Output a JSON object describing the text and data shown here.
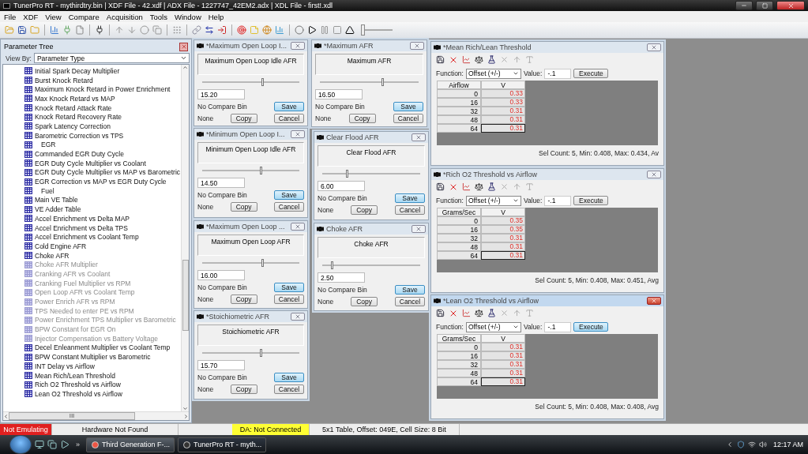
{
  "window": {
    "title": "TunerPro RT - mythirdtry.bin | XDF File - 42.xdf | ADX File - 1227747_42EM2.adx | XDL File - first!.xdl"
  },
  "menu": [
    "File",
    "XDF",
    "View",
    "Compare",
    "Acquisition",
    "Tools",
    "Window",
    "Help"
  ],
  "toolbar_slider": {
    "level": 0
  },
  "parameter_tree": {
    "title": "Parameter Tree",
    "view_by_label": "View By:",
    "view_by_value": "Parameter Type",
    "items": [
      {
        "label": "Initial Spark Decay Multiplier",
        "kind": "table",
        "dimmed": false
      },
      {
        "label": "Burst Knock Retard",
        "kind": "table",
        "dimmed": false
      },
      {
        "label": "Maximum Knock Retard in Power Enrichment",
        "kind": "table",
        "dimmed": false
      },
      {
        "label": "Max Knock Retard vs MAP",
        "kind": "table",
        "dimmed": false
      },
      {
        "label": "Knock Retard Attack Rate",
        "kind": "table",
        "dimmed": false
      },
      {
        "label": "Knock Retard Recovery Rate",
        "kind": "table",
        "dimmed": false
      },
      {
        "label": "Spark Latency Correction",
        "kind": "table",
        "dimmed": false
      },
      {
        "label": "Barometric Correction vs TPS",
        "kind": "table",
        "dimmed": false
      },
      {
        "label": "EGR",
        "kind": "category",
        "dimmed": false
      },
      {
        "label": "Commanded EGR Duty Cycle",
        "kind": "table",
        "dimmed": false
      },
      {
        "label": "EGR Duty Cycle Multiplier vs Coolant",
        "kind": "table",
        "dimmed": false
      },
      {
        "label": "EGR Duty Cycle Multiplier vs MAP vs Barometric",
        "kind": "table",
        "dimmed": false
      },
      {
        "label": "EGR Correction vs MAP vs EGR Duty Cycle",
        "kind": "table",
        "dimmed": false
      },
      {
        "label": "Fuel",
        "kind": "category",
        "dimmed": false
      },
      {
        "label": "Main VE Table",
        "kind": "table",
        "dimmed": false
      },
      {
        "label": "VE Adder Table",
        "kind": "table",
        "dimmed": false
      },
      {
        "label": "Accel Enrichment vs Delta MAP",
        "kind": "table",
        "dimmed": false
      },
      {
        "label": "Accel Enrichment vs Delta TPS",
        "kind": "table",
        "dimmed": false
      },
      {
        "label": "Accel Enrichment vs Coolant Temp",
        "kind": "table",
        "dimmed": false
      },
      {
        "label": "Cold Engine AFR",
        "kind": "table",
        "dimmed": false
      },
      {
        "label": "Choke AFR",
        "kind": "table",
        "dimmed": false
      },
      {
        "label": "Choke AFR Multiplier",
        "kind": "table",
        "dimmed": true
      },
      {
        "label": "Cranking AFR vs Coolant",
        "kind": "table",
        "dimmed": true
      },
      {
        "label": "Cranking Fuel Multiplier vs RPM",
        "kind": "table",
        "dimmed": true
      },
      {
        "label": "Open Loop AFR vs Coolant Temp",
        "kind": "table",
        "dimmed": true
      },
      {
        "label": "Power Enrich AFR vs RPM",
        "kind": "table",
        "dimmed": true
      },
      {
        "label": "TPS Needed to enter PE vs RPM",
        "kind": "table",
        "dimmed": true
      },
      {
        "label": "Power Enrichment TPS Multiplier vs Barometric",
        "kind": "table",
        "dimmed": true
      },
      {
        "label": "BPW Constant for EGR On",
        "kind": "table",
        "dimmed": true
      },
      {
        "label": "Injector Compensation vs Battery Voltage",
        "kind": "table",
        "dimmed": true
      },
      {
        "label": "Decel Enleanment Multiplier vs Coolant Temp",
        "kind": "table",
        "dimmed": false
      },
      {
        "label": "BPW Constant Multiplier vs Barometric",
        "kind": "table",
        "dimmed": false
      },
      {
        "label": "INT Delay vs Airflow",
        "kind": "table",
        "dimmed": false
      },
      {
        "label": "Mean Rich/Lean Threshold",
        "kind": "table",
        "dimmed": false
      },
      {
        "label": "Rich O2 Threshold vs Airflow",
        "kind": "table",
        "dimmed": false
      },
      {
        "label": "Lean O2 Threshold vs Airflow",
        "kind": "table",
        "dimmed": false
      }
    ],
    "scroll_more": "III"
  },
  "scalar_windows": [
    {
      "title": "*Maximum Open Loop I...",
      "label": "Maximum Open Loop Idle AFR",
      "level": 0.62,
      "value": "15.20",
      "compare": "No Compare Bin",
      "compare_source": "None",
      "save": "Save",
      "copy": "Copy",
      "cancel": "Cancel"
    },
    {
      "title": "*Maximum AFR",
      "label": "Maximum AFR",
      "level": 0.63,
      "value": "16.50",
      "compare": "No Compare Bin",
      "compare_source": "None",
      "save": "Save",
      "copy": "Copy",
      "cancel": "Cancel"
    },
    {
      "title": "*Minimum Open Loop I...",
      "label": "Minimum Open Loop Idle AFR",
      "level": 0.6,
      "value": "14.50",
      "compare": "No Compare Bin",
      "compare_source": "None",
      "save": "Save",
      "copy": "Copy",
      "cancel": "Cancel"
    },
    {
      "title": "Clear Flood AFR",
      "label": "Clear Flood AFR",
      "level": 0.25,
      "value": "6.00",
      "compare": "No Compare Bin",
      "compare_source": "None",
      "save": "Save",
      "copy": "Copy",
      "cancel": "Cancel"
    },
    {
      "title": "*Maximum Open Loop ...",
      "label": "Maximum Open Loop AFR",
      "level": 0.62,
      "value": "16.00",
      "compare": "No Compare Bin",
      "compare_source": "None",
      "save": "Save",
      "copy": "Copy",
      "cancel": "Cancel"
    },
    {
      "title": "Choke AFR",
      "label": "Choke AFR",
      "level": 0.1,
      "value": "2.50",
      "compare": "No Compare Bin",
      "compare_source": "None",
      "save": "Save",
      "copy": "Copy",
      "cancel": "Cancel"
    },
    {
      "title": "*Stoichiometric AFR",
      "label": "Stoichiometric AFR",
      "level": 0.6,
      "value": "15.70",
      "compare": "No Compare Bin",
      "compare_source": "None",
      "save": "Save",
      "copy": "Copy",
      "cancel": "Cancel"
    }
  ],
  "table_windows": [
    {
      "title": "*Mean Rich/Lean Threshold",
      "active": false,
      "function_label": "Function:",
      "function": "Offset (+/-)",
      "value_label": "Value:",
      "value": "-.1",
      "execute": "Execute",
      "axis_header": "Airflow",
      "value_header": "V",
      "rows": [
        {
          "axis": "0",
          "value": "0.33",
          "focused": false
        },
        {
          "axis": "16",
          "value": "0.33",
          "focused": false
        },
        {
          "axis": "32",
          "value": "0.31",
          "focused": false
        },
        {
          "axis": "48",
          "value": "0.31",
          "focused": false
        },
        {
          "axis": "64",
          "value": "0.31",
          "focused": true
        }
      ],
      "status": "Sel Count: 5, Min: 0.408, Max: 0.434, Av"
    },
    {
      "title": "*Rich O2 Threshold vs Airflow",
      "active": false,
      "function_label": "Function:",
      "function": "Offset (+/-)",
      "value_label": "Value:",
      "value": "-.1",
      "execute": "Execute",
      "axis_header": "Grams/Sec",
      "value_header": "V",
      "rows": [
        {
          "axis": "0",
          "value": "0.35",
          "focused": false
        },
        {
          "axis": "16",
          "value": "0.35",
          "focused": false
        },
        {
          "axis": "32",
          "value": "0.31",
          "focused": false
        },
        {
          "axis": "48",
          "value": "0.31",
          "focused": false
        },
        {
          "axis": "64",
          "value": "0.31",
          "focused": true
        }
      ],
      "status": "Sel Count: 5, Min: 0.408, Max: 0.451, Avg"
    },
    {
      "title": "*Lean O2 Threshold vs Airflow",
      "active": true,
      "function_label": "Function:",
      "function": "Offset (+/-)",
      "value_label": "Value:",
      "value": "-.1",
      "execute": "Execute",
      "axis_header": "Grams/Sec",
      "value_header": "V",
      "rows": [
        {
          "axis": "0",
          "value": "0.31",
          "focused": false
        },
        {
          "axis": "16",
          "value": "0.31",
          "focused": false
        },
        {
          "axis": "32",
          "value": "0.31",
          "focused": false
        },
        {
          "axis": "48",
          "value": "0.31",
          "focused": false
        },
        {
          "axis": "64",
          "value": "0.31",
          "focused": true
        }
      ],
      "status": "Sel Count: 5, Min: 0.408, Max: 0.408, Avg"
    }
  ],
  "status_bar": {
    "emulation": "Not Emulating",
    "hardware": "Hardware Not Found",
    "da": "DA: Not Connected",
    "info": "5x1 Table, Offset: 049E, Cell Size: 8 Bit"
  },
  "taskbar": {
    "more": "»",
    "tasks": [
      {
        "label": "Third Generation F-...",
        "selected": false
      },
      {
        "label": "TunerPro RT - myth...",
        "selected": true
      }
    ],
    "clock": "12:17 AM"
  }
}
